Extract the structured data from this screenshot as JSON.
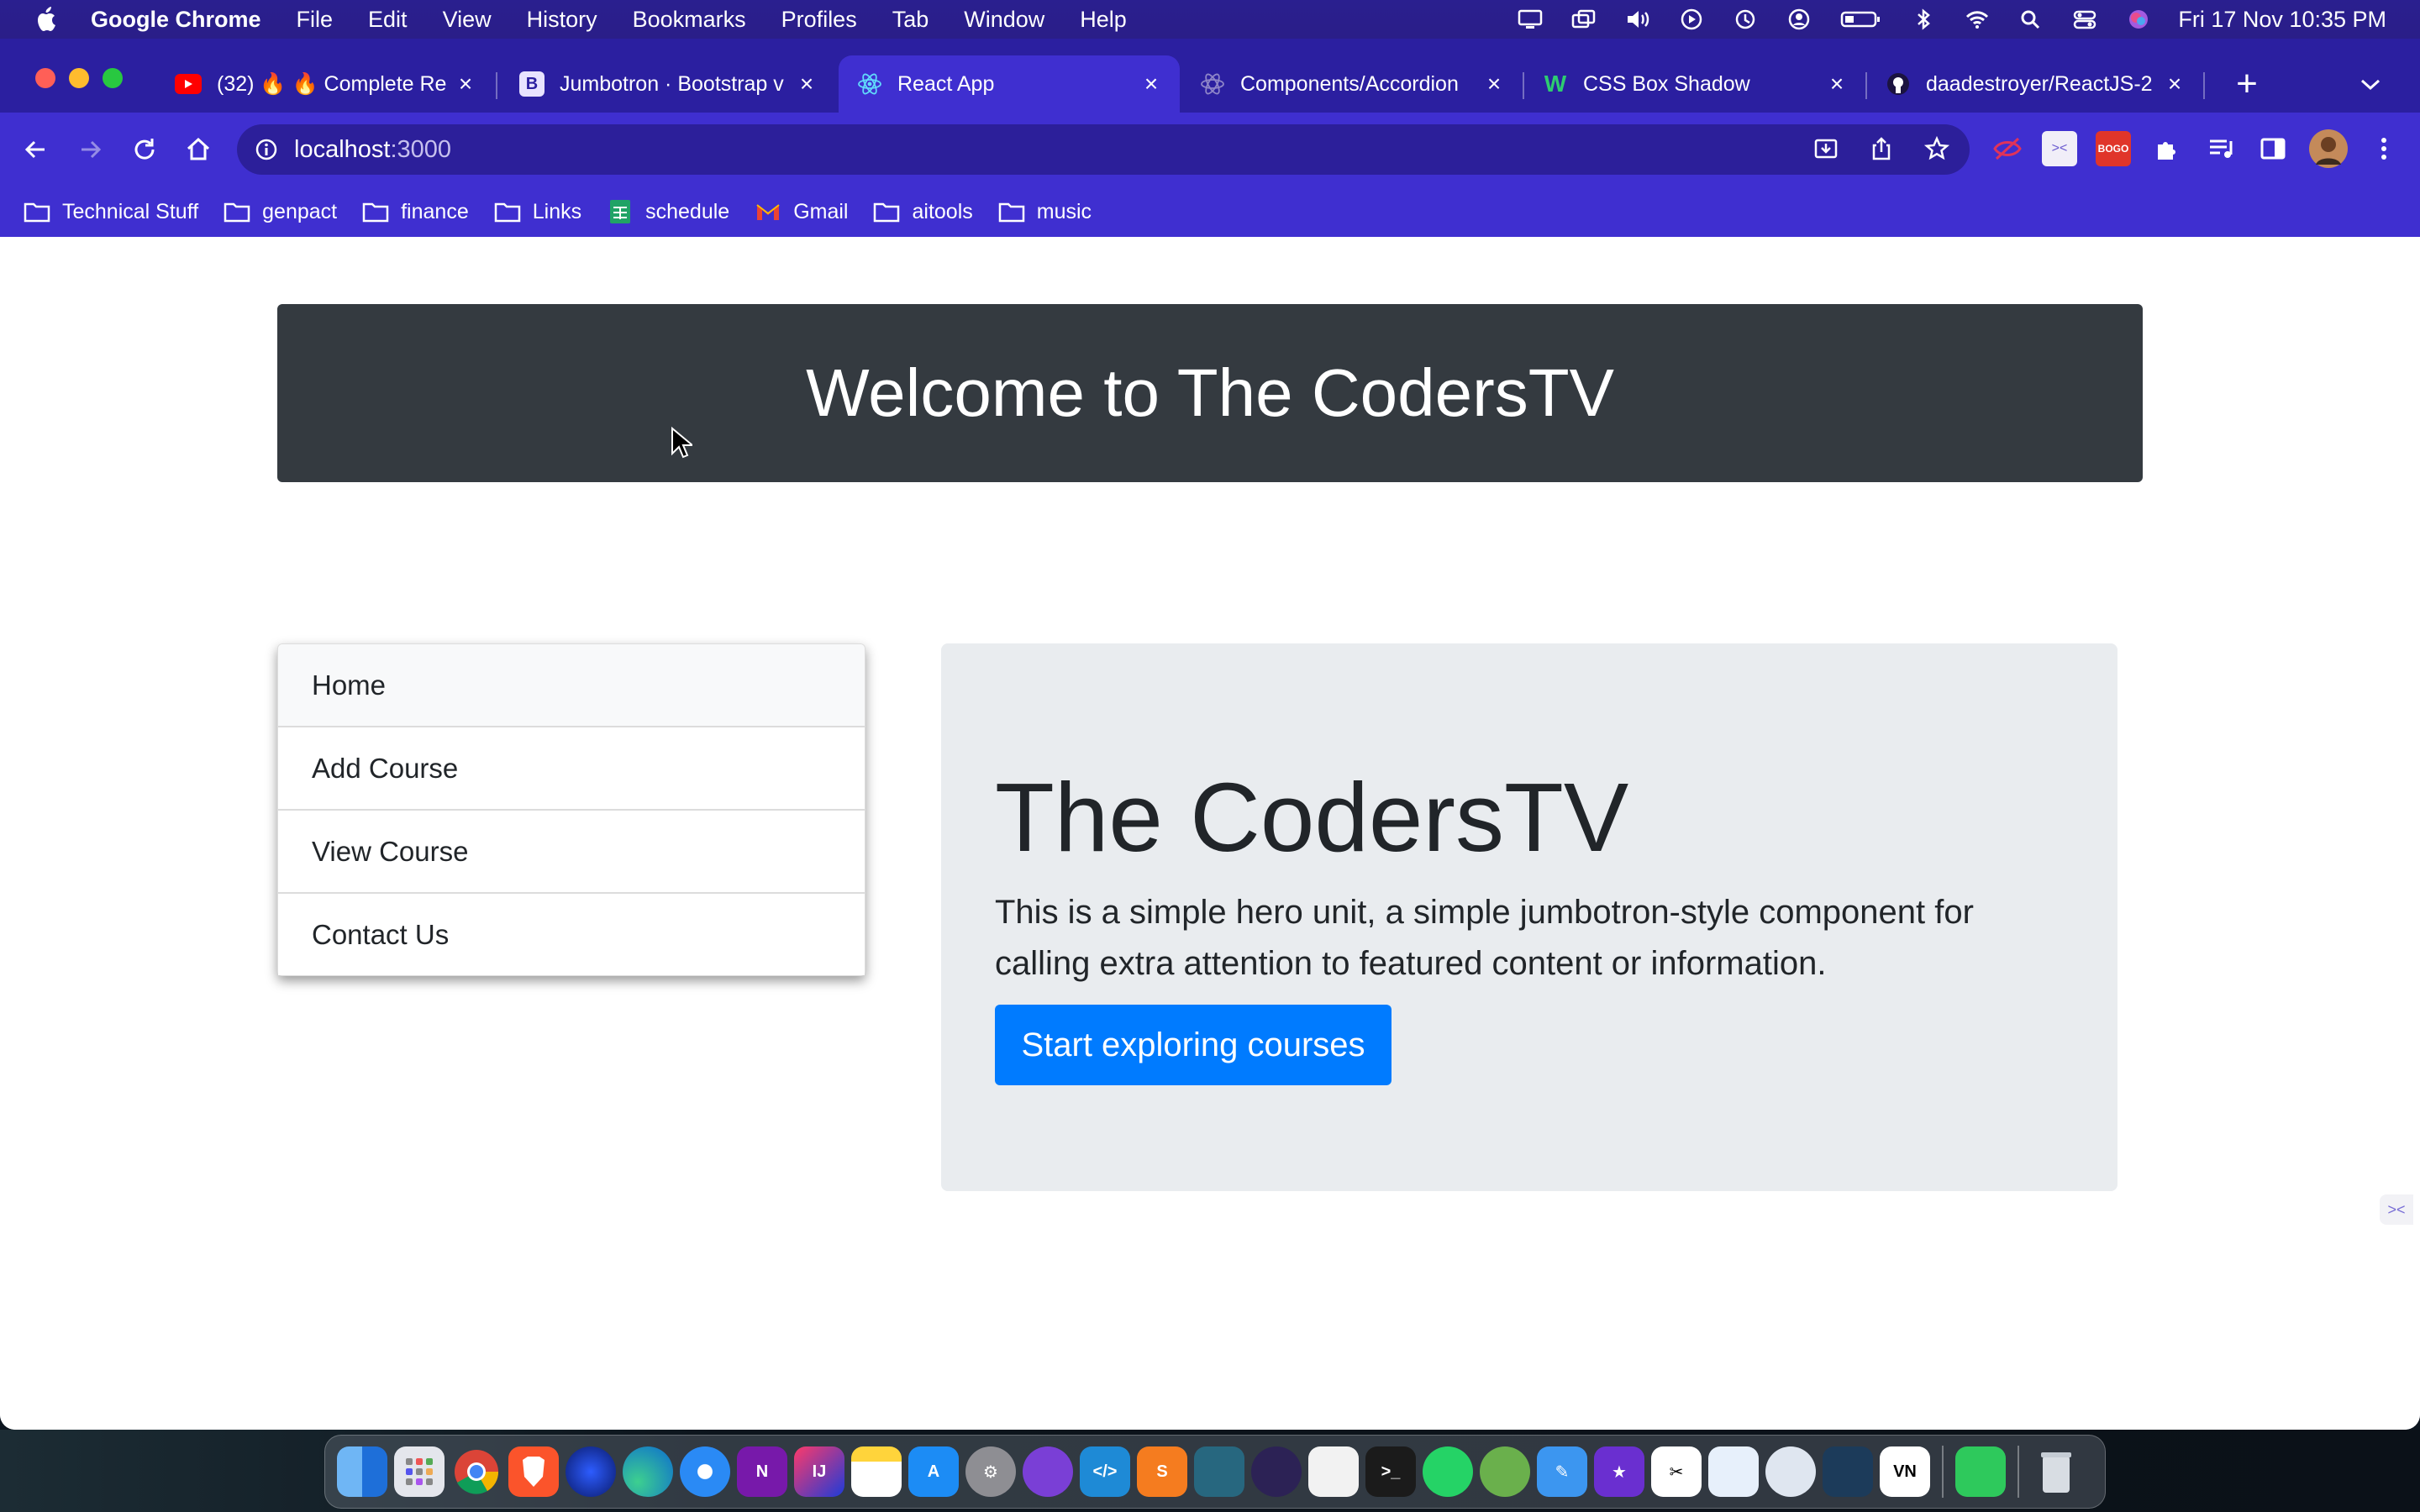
{
  "menubar": {
    "app_name": "Google Chrome",
    "items": [
      "File",
      "Edit",
      "View",
      "History",
      "Bookmarks",
      "Profiles",
      "Tab",
      "Window",
      "Help"
    ],
    "clock": "Fri 17 Nov  10:35 PM"
  },
  "tabs": [
    {
      "title": "(32) 🔥 🔥 Complete Re",
      "favicon": "youtube-icon",
      "active": false
    },
    {
      "title": "Jumbotron · Bootstrap v",
      "favicon": "bootstrap-icon",
      "active": false
    },
    {
      "title": "React App",
      "favicon": "react-icon",
      "active": true
    },
    {
      "title": "Components/Accordion",
      "favicon": "react-icon",
      "active": false
    },
    {
      "title": "CSS Box Shadow",
      "favicon": "w-icon",
      "active": false
    },
    {
      "title": "daadestroyer/ReactJS-2",
      "favicon": "github-icon",
      "active": false
    }
  ],
  "omnibox": {
    "host": "localhost",
    "port": ":3000"
  },
  "bookmarks": [
    {
      "label": "Technical Stuff",
      "icon": "folder-icon"
    },
    {
      "label": "genpact",
      "icon": "folder-icon"
    },
    {
      "label": "finance",
      "icon": "folder-icon"
    },
    {
      "label": "Links",
      "icon": "folder-icon"
    },
    {
      "label": "schedule",
      "icon": "sheets-icon"
    },
    {
      "label": "Gmail",
      "icon": "gmail-icon"
    },
    {
      "label": "aitools",
      "icon": "folder-icon"
    },
    {
      "label": "music",
      "icon": "folder-icon"
    }
  ],
  "page": {
    "header_title": "Welcome to The CodersTV",
    "menu": [
      "Home",
      "Add Course",
      "View Course",
      "Contact Us"
    ],
    "jumbotron": {
      "heading": "The CodersTV",
      "text": "This is a simple hero unit, a simple jumbotron-style component for calling extra attention to featured content or information.",
      "button": "Start exploring courses"
    }
  },
  "colors": {
    "chrome_tabstrip": "#2b1fa0",
    "chrome_toolbar": "#3f2fd0",
    "header_bg": "#343a40",
    "jumbotron_bg": "#e9ecef",
    "primary_button": "#007bff"
  },
  "dock": [
    "Finder",
    "Launchpad",
    "Chrome",
    "Brave",
    "Firefox",
    "Edge",
    "Safari",
    "OneNote",
    "IntelliJ",
    "Notes",
    "App Store",
    "System Settings",
    "GitHub Desktop",
    "VS Code",
    "Sublime",
    "MySQL Workbench",
    "Eclipse",
    "TextEdit",
    "Terminal",
    "WhatsApp",
    "Spring Tools",
    "Pen",
    "iMovie",
    "CapCut",
    "Shield",
    "Proxyman",
    "Cursor",
    "VN",
    "FaceTime",
    "Trash"
  ]
}
